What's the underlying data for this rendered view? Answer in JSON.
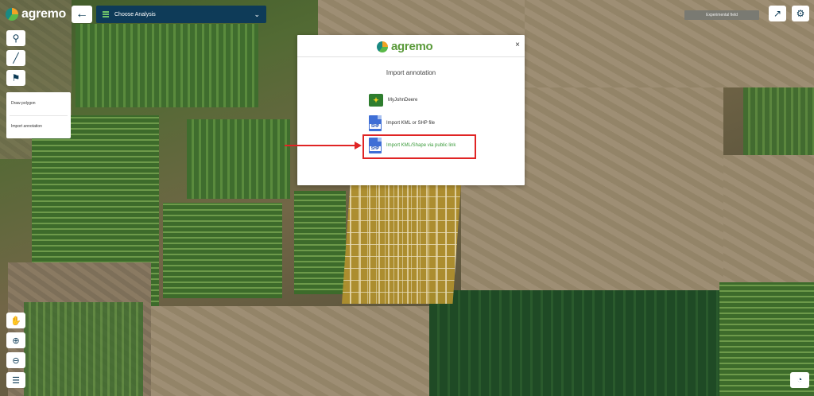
{
  "header": {
    "logo_text": "agremo",
    "analysis_select": "Choose Analysis",
    "field_name": "Experimental field"
  },
  "left_tools": {
    "dropdown": {
      "items": [
        "Draw polygon",
        "Import annotation"
      ]
    }
  },
  "modal": {
    "logo_text": "agremo",
    "close": "×",
    "title": "Import annotation",
    "options": [
      {
        "label": "MyJohnDeere",
        "icon": "john-deere-icon"
      },
      {
        "label": "Import KML or SHP file",
        "icon": "shp-file-icon",
        "badge": "SHP"
      },
      {
        "label": "Import KML/Shape via public link",
        "icon": "shp-file-icon",
        "badge": "SHP"
      }
    ]
  },
  "colors": {
    "accent_navy": "#0e3b58",
    "brand_green": "#5a9a3a",
    "highlight_red": "#e02424"
  }
}
